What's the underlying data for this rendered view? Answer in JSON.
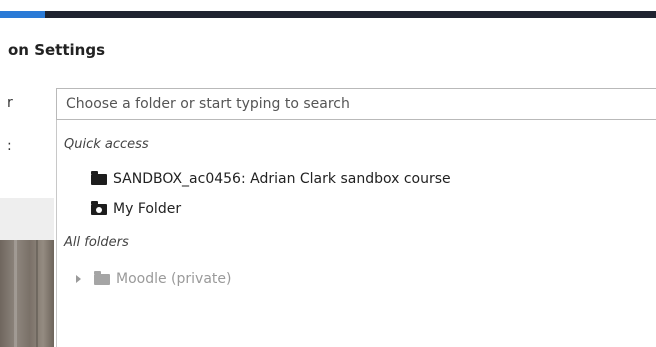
{
  "header": {
    "title": "on Settings"
  },
  "left_labels": {
    "folder_label_fragment": "r",
    "type_label_fragment": ":"
  },
  "search": {
    "placeholder": "Choose a folder or start typing to search"
  },
  "dropdown": {
    "quick_access_heading": "Quick access",
    "quick_access_items": [
      {
        "label": "SANDBOX_ac0456: Adrian Clark sandbox course",
        "icon": "folder-icon"
      },
      {
        "label": "My Folder",
        "icon": "user-folder-icon"
      }
    ],
    "all_folders_heading": "All folders",
    "all_folders_items": [
      {
        "label": "Moodle (private)",
        "icon": "folder-icon",
        "expander": "chevron-right-icon",
        "state": "disabled"
      }
    ]
  },
  "colors": {
    "topbar": "#1f2330",
    "accent": "#2b7ad6",
    "disabled_text": "#9a9a9a"
  }
}
